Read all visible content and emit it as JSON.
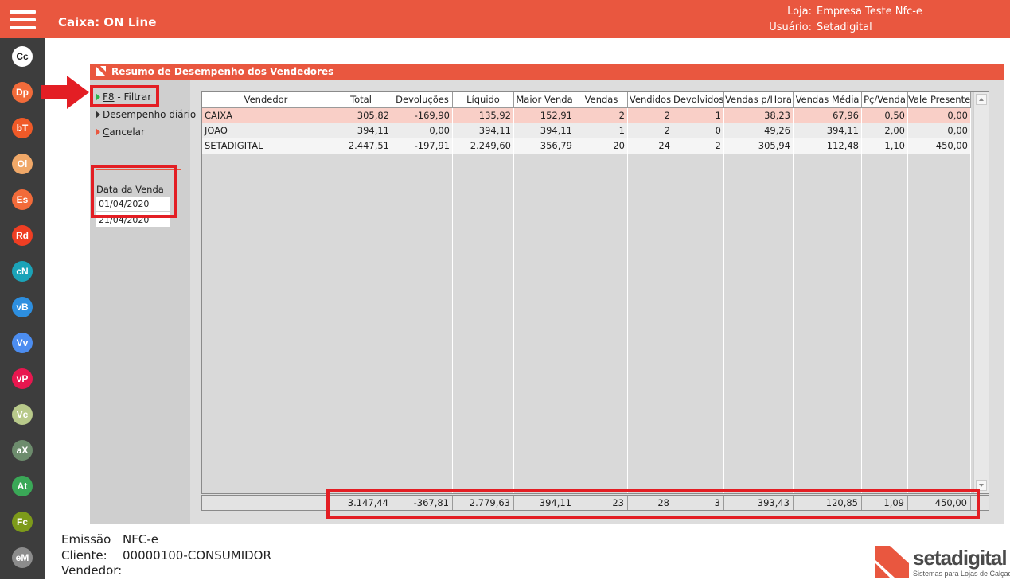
{
  "app": {
    "title": "Caixa: ON Line",
    "loja_label": "Loja:",
    "loja_value": "Empresa Teste Nfc-e",
    "usuario_label": "Usuário:",
    "usuario_value": "Setadigital"
  },
  "sidebar": {
    "items": [
      {
        "label": "Cc",
        "bg": "#ffffff",
        "fg": "#222222"
      },
      {
        "label": "Dp",
        "bg": "#f26b3a",
        "fg": "#ffffff"
      },
      {
        "label": "bT",
        "bg": "#f05a28",
        "fg": "#ffffff"
      },
      {
        "label": "Ol",
        "bg": "#f0a868",
        "fg": "#ffffff"
      },
      {
        "label": "Es",
        "bg": "#f26b3a",
        "fg": "#ffffff"
      },
      {
        "label": "Rd",
        "bg": "#ef3e23",
        "fg": "#ffffff"
      },
      {
        "label": "cN",
        "bg": "#1ba3b8",
        "fg": "#ffffff"
      },
      {
        "label": "vB",
        "bg": "#2d8fe0",
        "fg": "#ffffff"
      },
      {
        "label": "Vv",
        "bg": "#4c8df0",
        "fg": "#ffffff"
      },
      {
        "label": "vP",
        "bg": "#e8174f",
        "fg": "#ffffff"
      },
      {
        "label": "Vc",
        "bg": "#b8c98a",
        "fg": "#ffffff"
      },
      {
        "label": "aX",
        "bg": "#6d8c6d",
        "fg": "#ffffff"
      },
      {
        "label": "At",
        "bg": "#3aa857",
        "fg": "#ffffff"
      },
      {
        "label": "Fc",
        "bg": "#7d9a1a",
        "fg": "#ffffff"
      },
      {
        "label": "eM",
        "bg": "#8c8c8c",
        "fg": "#ffffff"
      }
    ]
  },
  "panel": {
    "title": "Resumo de Desempenho dos Vendedores",
    "menu": {
      "filtrar_key": "F8",
      "filtrar_rest": " - Filtrar",
      "desempenho_first": "D",
      "desempenho_rest": "esempenho diário",
      "cancelar_first": "C",
      "cancelar_rest": "ancelar"
    },
    "date": {
      "label": "Data da Venda",
      "start": "01/04/2020",
      "end": "21/04/2020"
    }
  },
  "table": {
    "columns": [
      "Vendedor",
      "Total",
      "Devoluções",
      "Líquido",
      "Maior Venda",
      "Vendas",
      "Vendidos",
      "Devolvidos",
      "Vendas p/Hora",
      "Vendas Média",
      "Pç/Venda",
      "Vale Presente"
    ],
    "rows": [
      [
        "CAIXA",
        "305,82",
        "-169,90",
        "135,92",
        "152,91",
        "2",
        "2",
        "1",
        "38,23",
        "67,96",
        "0,50",
        "0,00"
      ],
      [
        "JOAO",
        "394,11",
        "0,00",
        "394,11",
        "394,11",
        "1",
        "2",
        "0",
        "49,26",
        "394,11",
        "2,00",
        "0,00"
      ],
      [
        "SETADIGITAL",
        "2.447,51",
        "-197,91",
        "2.249,60",
        "356,79",
        "20",
        "24",
        "2",
        "305,94",
        "112,48",
        "1,10",
        "450,00"
      ]
    ],
    "totals": [
      "3.147,44",
      "-367,81",
      "2.779,63",
      "394,11",
      "23",
      "28",
      "3",
      "393,43",
      "120,85",
      "1,09",
      "450,00"
    ],
    "selected_row_bg": "#f9cfc7"
  },
  "footer": {
    "emissao_label": "Emissão",
    "emissao_value": "NFC-e",
    "cliente_label": "Cliente:",
    "cliente_value": "00000100-CONSUMIDOR",
    "vendedor_label": "Vendedor:",
    "vendedor_value": ""
  },
  "logo": {
    "name": "setadigital",
    "tagline": "Sistemas para Lojas de Calçados"
  },
  "colors": {
    "accent": "#e9573f",
    "highlight": "#e31e24"
  }
}
